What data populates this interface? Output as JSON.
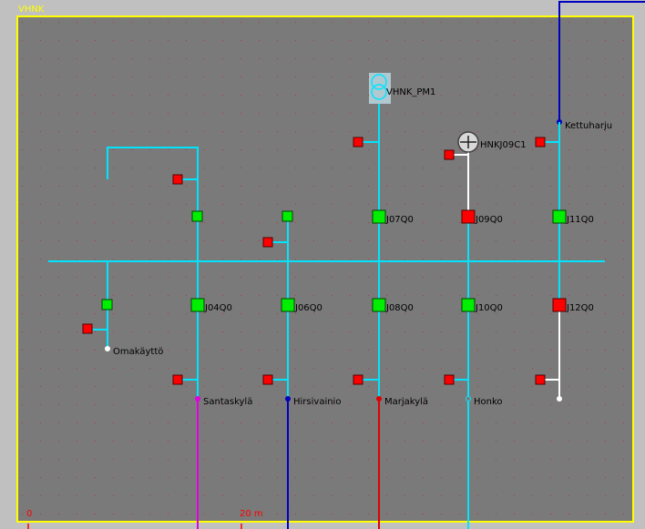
{
  "area_label": "VHNK",
  "scale": {
    "start": "0",
    "mark": "20 m"
  },
  "colors": {
    "background": "#c0c0c0",
    "canvas": "#7a7a7a",
    "frame": "#ffff00",
    "dots": "#c03030",
    "cable_cyan": "#00e5ff",
    "cable_white": "#ffffff",
    "feeder_magenta": "#e000e0",
    "feeder_blue": "#0000c0",
    "feeder_red": "#e00000",
    "switch_closed": "#00ee00",
    "switch_open": "#ff0000",
    "fuse": "#ff0000"
  },
  "transformer": {
    "label": "VHNK_PM1",
    "icon": "transformer-icon"
  },
  "generator": {
    "label": "HNKJ09C1",
    "icon": "generator-icon"
  },
  "switches": [
    {
      "id": "J04Q0",
      "label": "J04Q0",
      "state": "closed"
    },
    {
      "id": "J06Q0",
      "label": "J06Q0",
      "state": "closed"
    },
    {
      "id": "J07Q0",
      "label": "J07Q0",
      "state": "closed"
    },
    {
      "id": "J08Q0",
      "label": "J08Q0",
      "state": "closed"
    },
    {
      "id": "J09Q0",
      "label": "J09Q0",
      "state": "open"
    },
    {
      "id": "J10Q0",
      "label": "J10Q0",
      "state": "closed"
    },
    {
      "id": "J11Q0",
      "label": "J11Q0",
      "state": "closed"
    },
    {
      "id": "J12Q0",
      "label": "J12Q0",
      "state": "open"
    }
  ],
  "feeders": [
    {
      "label": "Omakäyttö"
    },
    {
      "label": "Santaskylä"
    },
    {
      "label": "Hirsivainio"
    },
    {
      "label": "Marjakylä"
    },
    {
      "label": "Honko"
    },
    {
      "label": "Kettuharju"
    }
  ]
}
